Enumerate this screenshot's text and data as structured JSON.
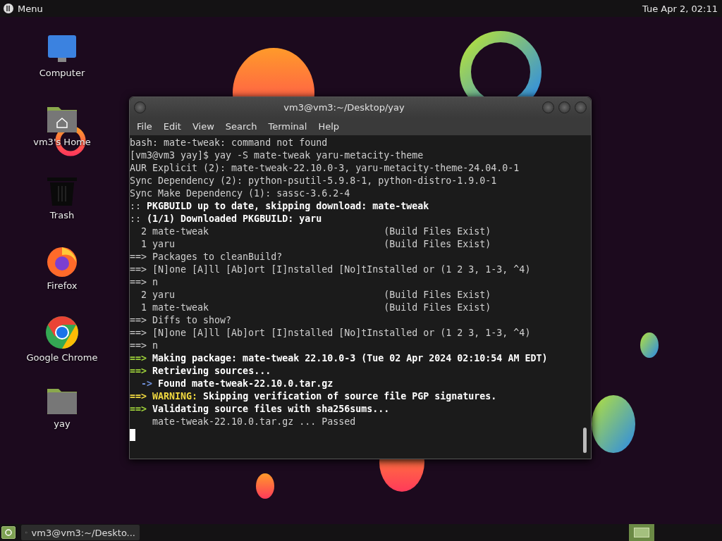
{
  "top_panel": {
    "menu_label": "Menu",
    "clock": "Tue Apr 2, 02:11"
  },
  "desktop_icons": [
    {
      "kind": "computer",
      "label": "Computer"
    },
    {
      "kind": "home",
      "label": "vm3's Home"
    },
    {
      "kind": "trash",
      "label": "Trash"
    },
    {
      "kind": "firefox",
      "label": "Firefox"
    },
    {
      "kind": "chrome",
      "label": "Google Chrome"
    },
    {
      "kind": "folder",
      "label": "yay"
    }
  ],
  "terminal": {
    "title": "vm3@vm3:~/Desktop/yay",
    "menu": [
      "File",
      "Edit",
      "View",
      "Search",
      "Terminal",
      "Help"
    ],
    "lines": [
      {
        "kind": "text",
        "parts": [
          {
            "text": "bash: mate-tweak: command not found",
            "kind": "plain"
          }
        ]
      },
      {
        "kind": "text",
        "parts": [
          {
            "text": "[vm3@vm3 yay]$ yay -S mate-tweak yaru-metacity-theme",
            "kind": "plain"
          }
        ]
      },
      {
        "kind": "text",
        "parts": [
          {
            "text": "AUR Explicit (2): mate-tweak-22.10.0-3, yaru-metacity-theme-24.04.0-1",
            "kind": "plain"
          }
        ]
      },
      {
        "kind": "text",
        "parts": [
          {
            "text": "Sync Dependency (2): python-psutil-5.9.8-1, python-distro-1.9.0-1",
            "kind": "plain"
          }
        ]
      },
      {
        "kind": "text",
        "parts": [
          {
            "text": "Sync Make Dependency (1): sassc-3.6.2-4",
            "kind": "plain"
          }
        ]
      },
      {
        "kind": "text",
        "parts": [
          {
            "text": "::",
            "kind": "plain"
          },
          {
            "text": " PKGBUILD up to date, skipping download: mate-tweak",
            "kind": "bold"
          }
        ]
      },
      {
        "kind": "text",
        "parts": [
          {
            "text": "::",
            "kind": "plain"
          },
          {
            "text": " (1/1) Downloaded PKGBUILD: yaru",
            "kind": "bold"
          }
        ]
      },
      {
        "kind": "package",
        "number": "2",
        "name": "mate-tweak",
        "status": "(Build Files Exist)"
      },
      {
        "kind": "package",
        "number": "1",
        "name": "yaru",
        "status": "(Build Files Exist)"
      },
      {
        "kind": "text",
        "parts": [
          {
            "text": "==> Packages to cleanBuild?",
            "kind": "plain"
          }
        ]
      },
      {
        "kind": "text",
        "parts": [
          {
            "text": "==> [N]one [A]ll [Ab]ort [I]nstalled [No]tInstalled or (1 2 3, 1-3, ^4)",
            "kind": "plain"
          }
        ]
      },
      {
        "kind": "text",
        "parts": [
          {
            "text": "==> n",
            "kind": "plain"
          }
        ]
      },
      {
        "kind": "package",
        "number": "2",
        "name": "yaru",
        "status": "(Build Files Exist)"
      },
      {
        "kind": "package",
        "number": "1",
        "name": "mate-tweak",
        "status": "(Build Files Exist)"
      },
      {
        "kind": "text",
        "parts": [
          {
            "text": "==> Diffs to show?",
            "kind": "plain"
          }
        ]
      },
      {
        "kind": "text",
        "parts": [
          {
            "text": "==> [N]one [A]ll [Ab]ort [I]nstalled [No]tInstalled or (1 2 3, 1-3, ^4)",
            "kind": "plain"
          }
        ]
      },
      {
        "kind": "text",
        "parts": [
          {
            "text": "==> n",
            "kind": "plain"
          }
        ]
      },
      {
        "kind": "text",
        "parts": [
          {
            "text": "==>",
            "kind": "green"
          },
          {
            "text": " Making package: mate-tweak 22.10.0-3 (Tue 02 Apr 2024 02:10:54 AM EDT)",
            "kind": "bold"
          }
        ]
      },
      {
        "kind": "text",
        "parts": [
          {
            "text": "==>",
            "kind": "green"
          },
          {
            "text": " Retrieving sources...",
            "kind": "bold"
          }
        ]
      },
      {
        "kind": "text",
        "parts": [
          {
            "text": "  ->",
            "kind": "blue"
          },
          {
            "text": " Found mate-tweak-22.10.0.tar.gz",
            "kind": "bold"
          }
        ]
      },
      {
        "kind": "text",
        "parts": [
          {
            "text": "==>",
            "kind": "yellow"
          },
          {
            "text": " WARNING:",
            "kind": "yellow"
          },
          {
            "text": " Skipping verification of source file PGP signatures.",
            "kind": "bold"
          }
        ]
      },
      {
        "kind": "text",
        "parts": [
          {
            "text": "==>",
            "kind": "green"
          },
          {
            "text": " Validating source files with sha256sums...",
            "kind": "bold"
          }
        ]
      },
      {
        "kind": "text",
        "parts": [
          {
            "text": "    mate-tweak-22.10.0.tar.gz ... Passed",
            "kind": "plain"
          }
        ]
      }
    ]
  },
  "taskbar": {
    "items": [
      {
        "label": "vm3@vm3:~/Deskto..."
      }
    ]
  }
}
